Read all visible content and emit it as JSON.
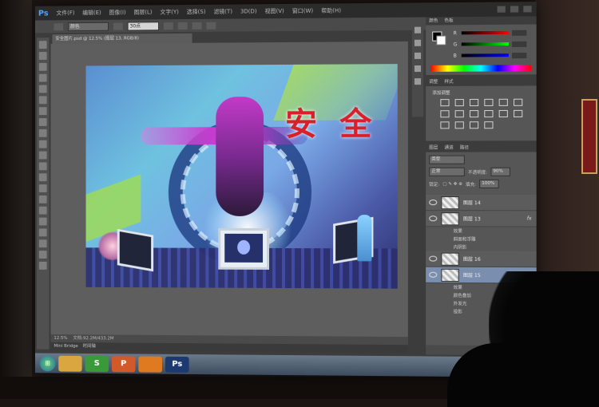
{
  "app": {
    "logo": "Ps",
    "menu": [
      "文件(F)",
      "编辑(E)",
      "图像(I)",
      "图层(L)",
      "文字(Y)",
      "选择(S)",
      "滤镜(T)",
      "3D(D)",
      "视图(V)",
      "窗口(W)",
      "帮助(H)"
    ]
  },
  "options": {
    "mode": "颜色",
    "size": "30点"
  },
  "document": {
    "tab": "安全图片.psd @ 12.5% (图层 13, RGB/8)",
    "artwork_text_1": "安",
    "artwork_text_2": "全"
  },
  "status": {
    "zoom": "12.5%",
    "doc_info": "文档:92.2M/433.2M"
  },
  "minibridge": {
    "left": "Mini Bridge",
    "right": "时间轴"
  },
  "color_panel": {
    "tabs": [
      "颜色",
      "色板"
    ],
    "channels": [
      "R",
      "G",
      "B"
    ]
  },
  "adjust_panel": {
    "tabs": [
      "调整",
      "样式"
    ],
    "title": "添加调整"
  },
  "layers_panel": {
    "tabs": [
      "图层",
      "通道",
      "路径"
    ],
    "kind": "类型",
    "blend": "正常",
    "opacity_label": "不透明度:",
    "opacity": "90%",
    "lock_label": "锁定:",
    "fill_label": "填充:",
    "fill": "100%",
    "layers": [
      {
        "name": "图层 14"
      },
      {
        "name": "图层 13",
        "fx": "fx",
        "effects_label": "效果",
        "effects": [
          "斜面和浮雕",
          "内阴影"
        ]
      },
      {
        "name": "图层 16"
      },
      {
        "name": "图层 15",
        "fx": "fx",
        "effects_label": "效果",
        "effects": [
          "颜色叠加",
          "外发光",
          "投影"
        ]
      }
    ]
  },
  "taskbar": {
    "apps": [
      {
        "label": "",
        "color": "#d9a640"
      },
      {
        "label": "S",
        "color": "#3a9a3a"
      },
      {
        "label": "P",
        "color": "#d25a2a"
      },
      {
        "label": "",
        "color": "#e07a20"
      },
      {
        "label": "Ps",
        "color": "#1d3a70"
      }
    ]
  }
}
